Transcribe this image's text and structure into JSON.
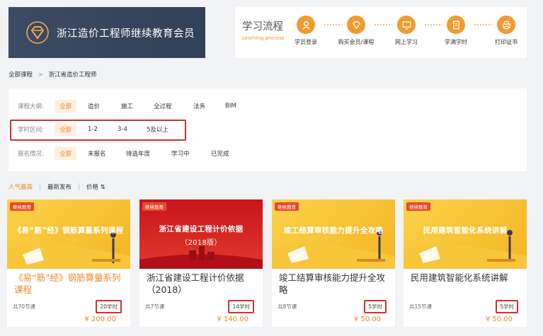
{
  "banner": {
    "title": "浙江造价工程师继续教育会员"
  },
  "flow": {
    "title": "学习流程",
    "subtitle": "Learning process",
    "steps": [
      {
        "label": "学员登录",
        "icon": "user-icon"
      },
      {
        "label": "购买会员/课程",
        "icon": "diamond-icon"
      },
      {
        "label": "网上学习",
        "icon": "monitor-icon"
      },
      {
        "label": "学满学时",
        "icon": "document-icon"
      },
      {
        "label": "打印证书",
        "icon": "printer-icon"
      }
    ]
  },
  "breadcrumb": {
    "root": "全部课程",
    "sep": ">",
    "current": "浙江省造价工程师"
  },
  "filters": {
    "outline": {
      "label": "课程大纲:",
      "options": [
        "全部",
        "造价",
        "施工",
        "全过程",
        "法务",
        "BIM"
      ]
    },
    "hours": {
      "label": "学时区间:",
      "options": [
        "全部",
        "1-2",
        "3-4",
        "5及以上"
      ]
    },
    "signup": {
      "label": "报名情况:",
      "options": [
        "全部",
        "未报名",
        "待选年度",
        "学习中",
        "已完成"
      ]
    }
  },
  "sort": {
    "options": [
      "人气最高",
      "最新发布",
      "价格 ⇅"
    ]
  },
  "colors": {
    "accent": "#ef8a2a",
    "highlight_box": "#d32f2f"
  },
  "courses": [
    {
      "tag": "继续教育",
      "thumb_text": "《易“筋”经》钢筋算量系列课程",
      "title": "《易“筋”经》钢筋算量系列课程",
      "lessons": "共70节课",
      "hours": "20学时",
      "price": "¥ 200.00"
    },
    {
      "tag": "继续教育",
      "thumb_text": "浙江省建设工程计价依据",
      "thumb_sub": "（2018版）",
      "title": "浙江省建设工程计价依据（2018）",
      "lessons": "共7节课",
      "hours": "14学时",
      "price": "¥ 140.00"
    },
    {
      "tag": "继续教育",
      "thumb_text": "竣工结算审核能力提升全攻略",
      "title": "竣工结算审核能力提升全攻略",
      "lessons": "共8节课",
      "hours": "5学时",
      "price": "¥ 50.00"
    },
    {
      "tag": "继续教育",
      "thumb_text": "民用建筑智能化系统讲解",
      "title": "民用建筑智能化系统讲解",
      "lessons": "共15节课",
      "hours": "5学时",
      "price": "¥ 50.00"
    }
  ]
}
